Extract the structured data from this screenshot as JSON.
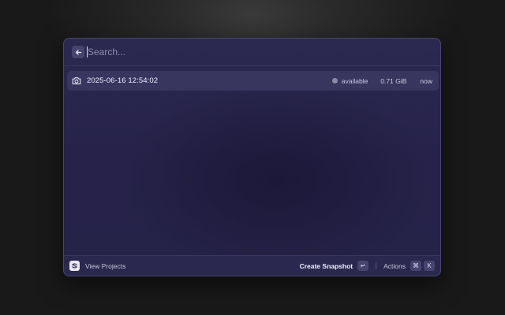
{
  "search": {
    "placeholder": "Search..."
  },
  "icons": {
    "back": "arrow-left-icon",
    "row": "camera-icon",
    "status": "status-dot-icon",
    "logo": "app-logo-icon"
  },
  "snapshots": [
    {
      "title": "2025-06-16 12:54:02",
      "status": "available",
      "size": "0.71 GiB",
      "time": "now"
    }
  ],
  "footer": {
    "view_projects": "View Projects",
    "primary_action": "Create Snapshot",
    "enter_key": "↵",
    "secondary_action": "Actions",
    "cmd_key": "⌘",
    "k_key": "K"
  },
  "colors": {
    "window_bg": "#27244b",
    "selected_row": "#38355e",
    "status_dot": "#8d8aa8",
    "page_bg": "#191919"
  }
}
